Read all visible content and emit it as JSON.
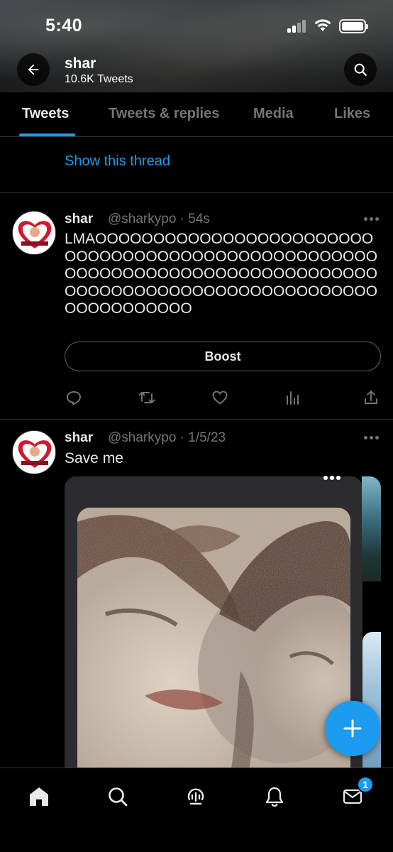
{
  "status_bar": {
    "time": "5:40"
  },
  "profile": {
    "name": "shar",
    "tweet_count": "10.6K Tweets"
  },
  "tabs": [
    {
      "label": "Tweets",
      "active": true
    },
    {
      "label": "Tweets & replies",
      "active": false
    },
    {
      "label": "Media",
      "active": false
    },
    {
      "label": "Likes",
      "active": false
    }
  ],
  "thread": {
    "show_thread_label": "Show this thread"
  },
  "tweets": [
    {
      "name": "shar",
      "meta": "@sharkypo · 54s",
      "text": "LMAOOOOOOOOOOOOOOOOOOOOOOOOOOOOOOOOOOOOOOOOOOOOOOOOOOOOOOOOOOOOOOOOOOOOOOOOOOOOOOOOOOOOOOOOOOOOOOOOOOOOOOOOOOOOOOOOOOOO",
      "boost_label": "Boost"
    },
    {
      "name": "shar",
      "meta": "@sharkypo · 1/5/23",
      "text": "Save me"
    }
  ],
  "bottom_nav": {
    "messages_badge": "1"
  },
  "colors": {
    "accent": "#1d9bf0",
    "background": "#000000",
    "muted": "#71767b",
    "divider": "#2f3336"
  },
  "icons": [
    "back-arrow-icon",
    "search-icon",
    "reply-icon",
    "retweet-icon",
    "like-icon",
    "views-icon",
    "share-icon",
    "more-icon",
    "compose-plus-icon",
    "home-icon",
    "explore-icon",
    "spaces-icon",
    "notifications-icon",
    "messages-icon"
  ]
}
